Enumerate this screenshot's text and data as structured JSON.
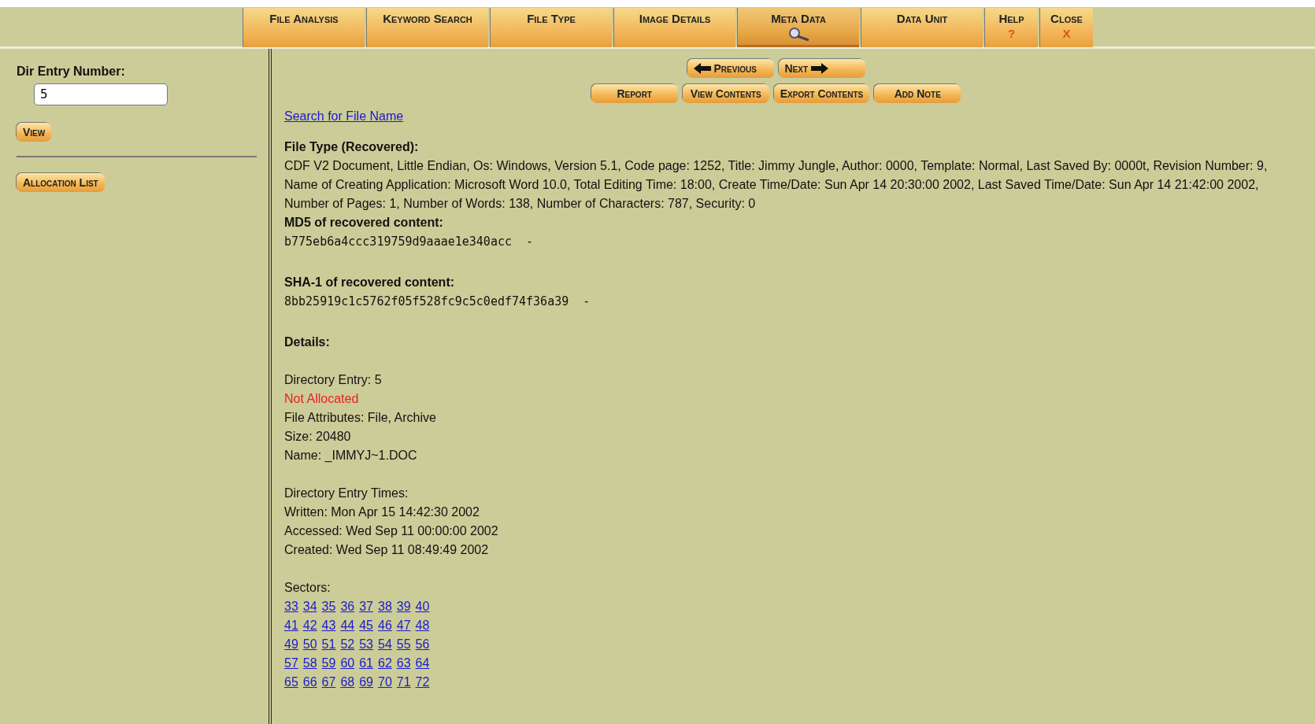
{
  "toolbar": [
    {
      "label": "File Analysis",
      "selected": false
    },
    {
      "label": "Keyword Search",
      "selected": false
    },
    {
      "label": "File Type",
      "selected": false
    },
    {
      "label": "Image Details",
      "selected": false
    },
    {
      "label": "Meta Data",
      "selected": true
    },
    {
      "label": "Data Unit",
      "selected": false
    },
    {
      "label": "Help",
      "selected": false,
      "glyph": "?"
    },
    {
      "label": "Close",
      "selected": false,
      "glyph": "X"
    }
  ],
  "sidebar": {
    "label": "Dir Entry Number:",
    "value": "5",
    "view_button": "View",
    "allocation_button": "Allocation List"
  },
  "nav_buttons": [
    "Previous",
    "Next"
  ],
  "action_buttons": [
    "Report",
    "View Contents",
    "Export Contents",
    "Add Note"
  ],
  "search_link": "Search for File Name",
  "file_type": {
    "heading": "File Type (Recovered):",
    "text": "CDF V2 Document, Little Endian, Os: Windows, Version 5.1, Code page: 1252, Title: Jimmy Jungle, Author: 0000, Template: Normal, Last Saved By: 0000t, Revision Number: 9, Name of Creating Application: Microsoft Word 10.0, Total Editing Time: 18:00, Create Time/Date: Sun Apr 14 20:30:00 2002, Last Saved Time/Date: Sun Apr 14 21:42:00 2002, Number of Pages: 1, Number of Words: 138, Number of Characters: 787, Security: 0"
  },
  "md5": {
    "heading": "MD5 of recovered content:",
    "value": "b775eb6a4ccc319759d9aaae1e340acc  -"
  },
  "sha1": {
    "heading": "SHA-1 of recovered content:",
    "value": "8bb25919c1c5762f05f528fc9c5c0edf74f36a39  -"
  },
  "details": {
    "heading": "Details:",
    "entry": [
      {
        "text": "Directory Entry: 5",
        "kind": "plain"
      },
      {
        "text": "Not Allocated",
        "kind": "alert"
      },
      {
        "text": "File Attributes: File, Archive",
        "kind": "plain"
      },
      {
        "text": "Size: 20480",
        "kind": "plain"
      },
      {
        "text": "Name: _IMMYJ~1.DOC",
        "kind": "plain"
      }
    ],
    "times": [
      "Directory Entry Times:",
      "Written: Mon Apr 15 14:42:30 2002",
      "Accessed: Wed Sep 11 00:00:00 2002",
      "Created: Wed Sep 11 08:49:49 2002"
    ],
    "sectors_label": "Sectors:",
    "sectors": [
      [
        "33",
        "34",
        "35",
        "36",
        "37",
        "38",
        "39",
        "40"
      ],
      [
        "41",
        "42",
        "43",
        "44",
        "45",
        "46",
        "47",
        "48"
      ],
      [
        "49",
        "50",
        "51",
        "52",
        "53",
        "54",
        "55",
        "56"
      ],
      [
        "57",
        "58",
        "59",
        "60",
        "61",
        "62",
        "63",
        "64"
      ],
      [
        "65",
        "66",
        "67",
        "68",
        "69",
        "70",
        "71",
        "72"
      ]
    ]
  }
}
